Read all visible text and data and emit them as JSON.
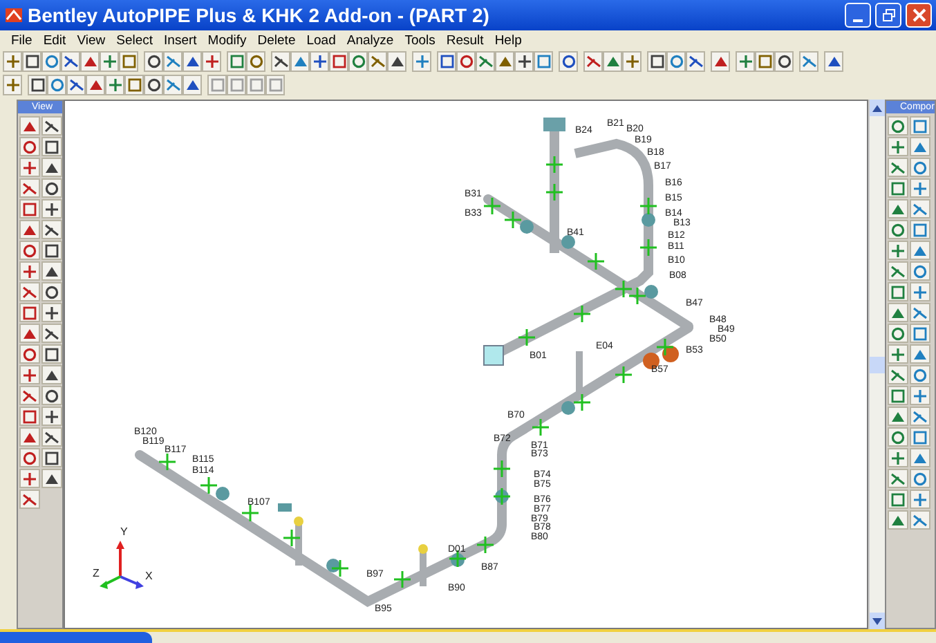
{
  "window": {
    "title": "Bentley AutoPIPE Plus & KHK 2 Add-on - (PART 2)"
  },
  "menu": [
    "File",
    "Edit",
    "View",
    "Select",
    "Insert",
    "Modify",
    "Delete",
    "Load",
    "Analyze",
    "Tools",
    "Result",
    "Help"
  ],
  "left_palette": {
    "title": "View"
  },
  "right_palette": {
    "title": "Compor"
  },
  "node_labels": [
    "B24",
    "B21",
    "B20",
    "B19",
    "B18",
    "B17",
    "B16",
    "B15",
    "B14",
    "B13",
    "B12",
    "B11",
    "B10",
    "B08",
    "B31",
    "B33",
    "B41",
    "B47",
    "B48",
    "B49",
    "B50",
    "B53",
    "B01",
    "E04",
    "B57",
    "B70",
    "B72",
    "B71",
    "B73",
    "B74",
    "B75",
    "B76",
    "B77",
    "B79",
    "B78",
    "B80",
    "B120",
    "B119",
    "B117",
    "B115",
    "B114",
    "B107",
    "B97",
    "B95",
    "D01",
    "B90",
    "B87"
  ],
  "axes": [
    "Y",
    "Z",
    "X"
  ]
}
